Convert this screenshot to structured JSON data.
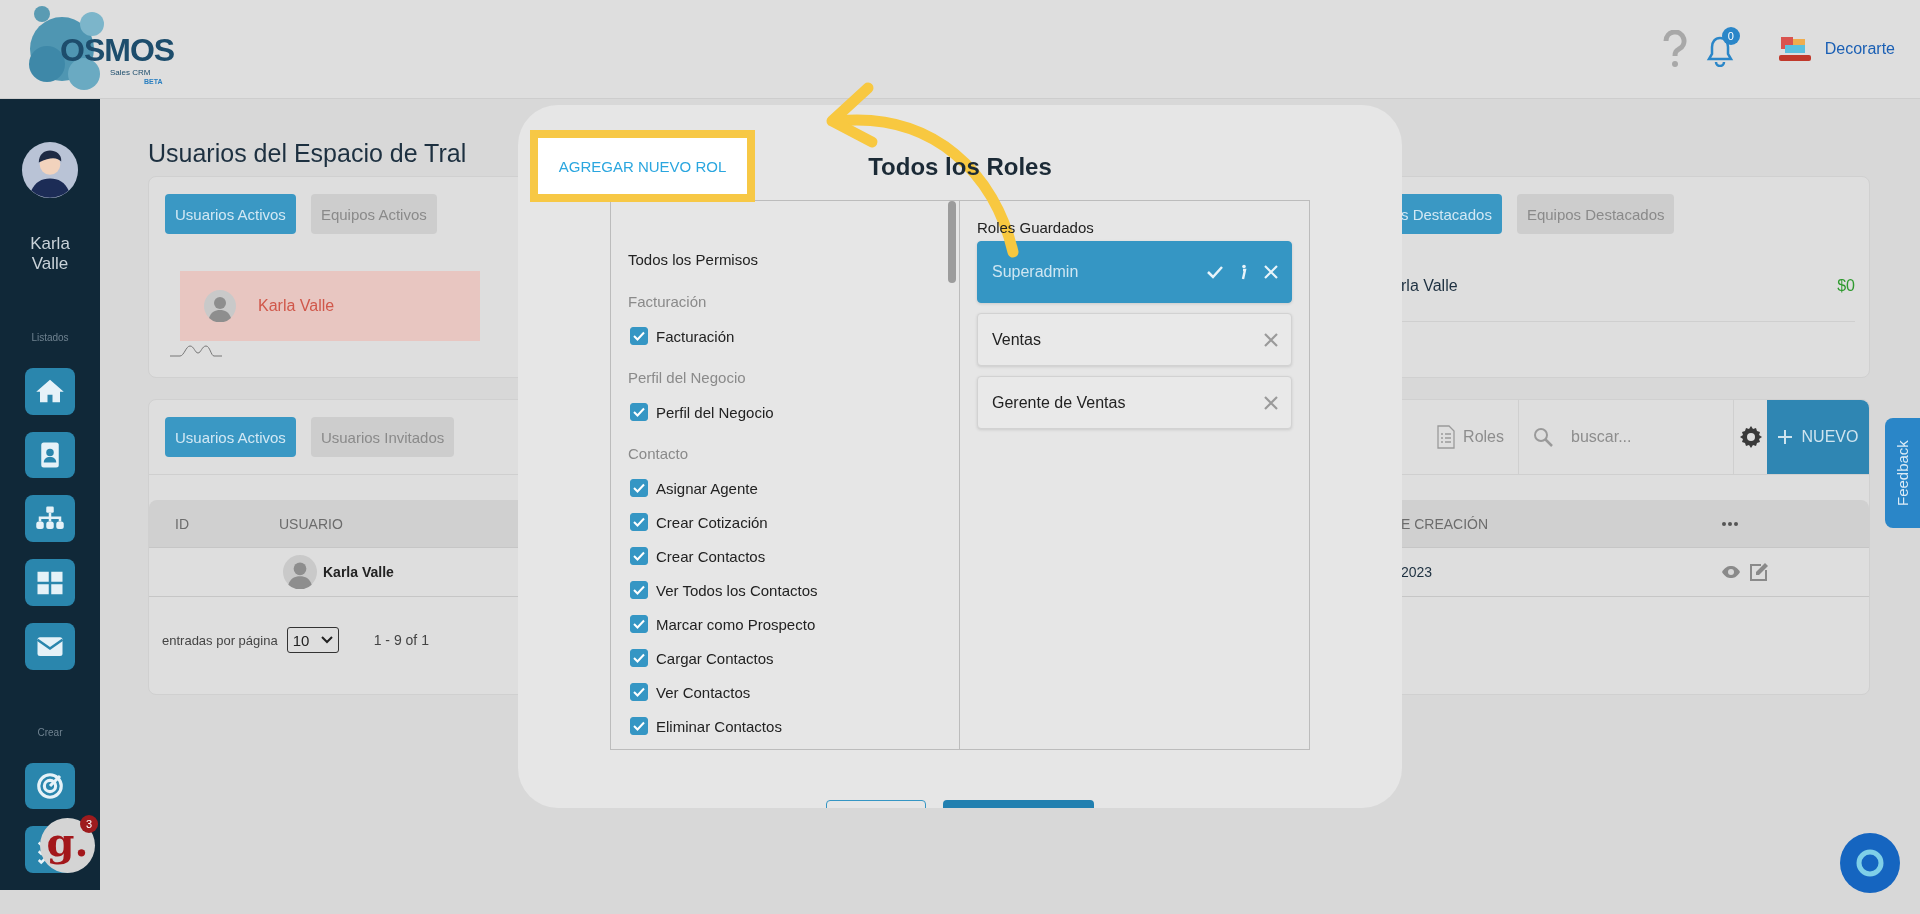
{
  "header": {
    "logo_text": "OSMOS",
    "logo_tagline": "Sales CRM",
    "logo_badge": "BETA",
    "notification_count": "0",
    "account_name": "Decorarte"
  },
  "sidebar": {
    "user_name": "Karla Valle",
    "sections": [
      {
        "label": "Listados",
        "items": [
          {
            "kind": "home"
          },
          {
            "kind": "contact"
          },
          {
            "kind": "sitemap"
          },
          {
            "kind": "grid"
          },
          {
            "kind": "mail"
          }
        ]
      },
      {
        "label": "Crear",
        "items": [
          {
            "kind": "target"
          },
          {
            "kind": "checklist"
          }
        ]
      }
    ]
  },
  "page": {
    "title": "Usuarios del Espacio de Tral",
    "summary_card": {
      "tabs": [
        {
          "label": "Usuarios Activos",
          "selected": true
        },
        {
          "label": "Equipos Activos",
          "selected": false
        }
      ],
      "featured_user": "Karla Valle",
      "tabs_right": [
        {
          "label": "s Destacados",
          "selected": true
        },
        {
          "label": "Equipos Destacados",
          "selected": false
        }
      ],
      "ranking": {
        "name": "rla Valle",
        "amount": "$0"
      }
    },
    "users_card": {
      "tabs": [
        {
          "label": "Usuarios Activos",
          "selected": true
        },
        {
          "label": "Usuarios Invitados",
          "selected": false
        }
      ],
      "toolbar": {
        "roles_label": "Roles",
        "search_placeholder": "buscar...",
        "new_label": "NUEVO"
      },
      "table": {
        "columns": [
          "ID",
          "USUARIO",
          "E CREACIÓN"
        ],
        "rows": [
          {
            "user": "Karla Valle",
            "date": "2023"
          }
        ]
      },
      "pagination": {
        "label": "entradas por página",
        "per_page": "10",
        "range": "1 - 9 of 1"
      }
    }
  },
  "modal": {
    "title": "Todos los Roles",
    "add_role_button": "AGREGAR NUEVO ROL",
    "permissions_heading": "Todos los Permisos",
    "groups": [
      {
        "label": "Facturación",
        "permissions": [
          {
            "label": "Facturación",
            "checked": true
          }
        ]
      },
      {
        "label": "Perfil del Negocio",
        "permissions": [
          {
            "label": "Perfil del Negocio",
            "checked": true
          }
        ]
      },
      {
        "label": "Contacto",
        "permissions": [
          {
            "label": "Asignar Agente",
            "checked": true
          },
          {
            "label": "Crear Cotización",
            "checked": true
          },
          {
            "label": "Crear Contactos",
            "checked": true
          },
          {
            "label": "Ver Todos los Contactos",
            "checked": true
          },
          {
            "label": "Marcar como Prospecto",
            "checked": true
          },
          {
            "label": "Cargar Contactos",
            "checked": true
          },
          {
            "label": "Ver Contactos",
            "checked": true
          },
          {
            "label": "Eliminar Contactos",
            "checked": true
          }
        ]
      }
    ],
    "saved_roles_heading": "Roles Guardados",
    "roles": [
      {
        "name": "Superadmin",
        "selected": true
      },
      {
        "name": "Ventas",
        "selected": false
      },
      {
        "name": "Gerente de Ventas",
        "selected": false
      }
    ]
  },
  "feedback_tab": "Feedback",
  "helper_widget": {
    "logo": "g.",
    "badge": "3"
  }
}
